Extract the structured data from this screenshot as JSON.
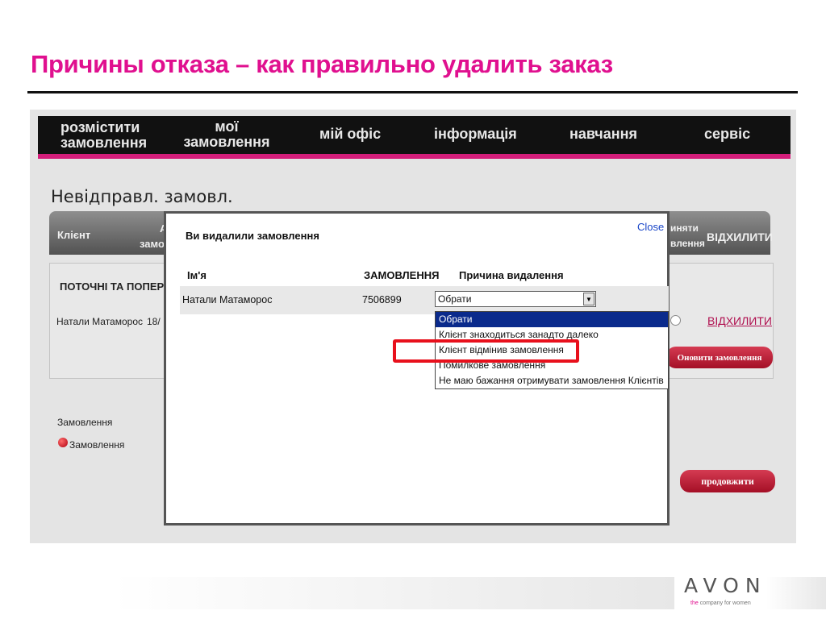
{
  "slide": {
    "title": "Причины отказа – как правильно удалить заказ"
  },
  "nav": {
    "items": [
      {
        "line1": "розмістити",
        "line2": "замовлення"
      },
      {
        "line1": "мої",
        "line2": "замовлення"
      },
      {
        "line1": "мій офіс"
      },
      {
        "line1": "інформація"
      },
      {
        "line1": "навчання"
      },
      {
        "line1": "сервіс"
      }
    ]
  },
  "page": {
    "heading": "Невідправл. замовл.",
    "table_bar": {
      "client_label": "Клієнт",
      "partial_a": "А",
      "partial_zamo": "замо",
      "partial_accept_1": "иняти",
      "partial_accept_2": "влення",
      "reject_label": "ВІДХИЛИТИ"
    },
    "current_section": {
      "title": "ПОТОЧНІ ТА ПОПЕРЕ,",
      "row_name": "Натали Матаморос",
      "row_date_partial": "18/",
      "reject_link": "ВІДХИЛИТИ",
      "update_button": "Оновити замовлення"
    },
    "legend": {
      "title": "Замовлення",
      "item": "Замовлення"
    },
    "continue_button": "продовжити"
  },
  "modal": {
    "title": "Ви видалили замовлення",
    "close": "Close",
    "columns": {
      "name": "Ім'я",
      "order": "ЗАМОВЛЕННЯ",
      "reason": "Причина видалення"
    },
    "row": {
      "name": "Натали Матаморос",
      "order": "7506899",
      "selected": "Обрати"
    },
    "options": [
      "Обрати",
      "Клієнт знаходиться занадто далеко",
      "Клієнт відмінив замовлення",
      "Помилкове замовлення",
      "Не маю бажання отримувати замовлення Клієнтів"
    ]
  },
  "footer": {
    "logo": "AVON",
    "tagline_pink": "the",
    "tagline_rest": "company for women"
  },
  "colors": {
    "accent_pink": "#e0108f",
    "nav_bg": "#111111",
    "highlight_red": "#e8101c",
    "selected_option": "#0a2a8c"
  }
}
